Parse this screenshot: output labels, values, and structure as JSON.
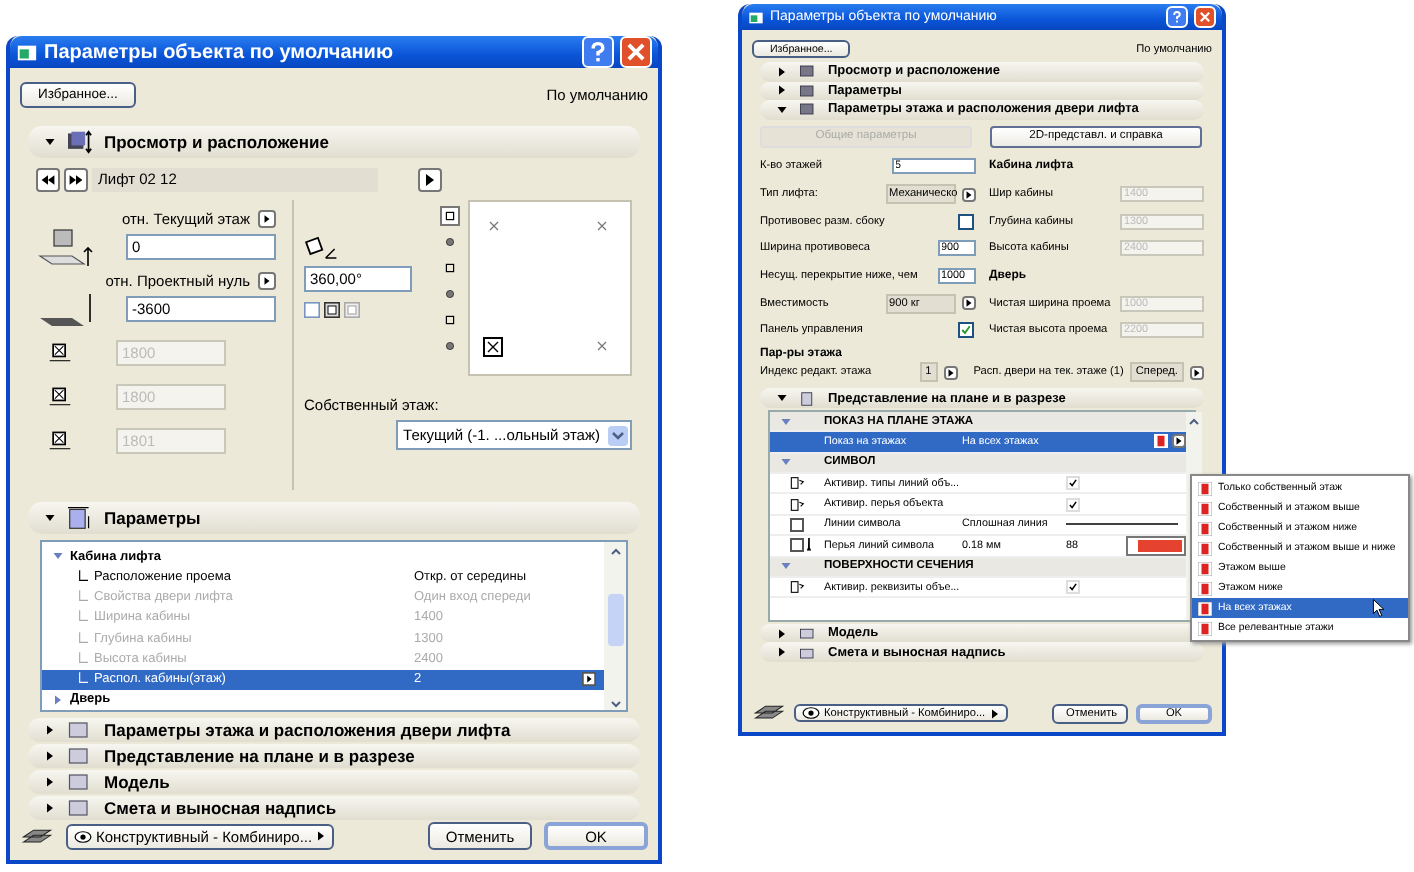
{
  "left_dialog": {
    "title": "Параметры объекта по умолчанию",
    "favorites_button": "Избранное...",
    "default_label": "По умолчанию",
    "placement": {
      "title": "Просмотр и расположение",
      "expanded": true,
      "library_part": "Лифт 02 12",
      "story_label": "отн. Текущий этаж",
      "story_value": "0",
      "zero_label": "отн. Проектный нуль",
      "zero_value": "-3600",
      "sizes": [
        {
          "value": "1800",
          "disabled": true
        },
        {
          "value": "1800",
          "disabled": true
        },
        {
          "value": "1801",
          "disabled": true
        }
      ],
      "angle": "360,00°",
      "views": [
        {
          "selected": true
        },
        {
          "selected": false
        },
        {
          "selected": false
        },
        {
          "selected": false
        },
        {
          "selected": false
        },
        {
          "selected": false
        }
      ],
      "own_story_label": "Собственный этаж:",
      "own_story_value": "Текущий (-1. ...ольный этаж)"
    },
    "parameters": {
      "title": "Параметры",
      "expanded": true,
      "tree": [
        {
          "name": "Кабина лифта",
          "expanded": true,
          "children": [
            {
              "name": "Расположение проема",
              "value": "Откр. от середины",
              "disabled": false,
              "selected": false
            },
            {
              "name": "Свойства двери лифта",
              "value": "Один вход спереди",
              "disabled": true,
              "selected": false
            },
            {
              "name": "Ширина кабины",
              "value": "1400",
              "disabled": true,
              "selected": false
            },
            {
              "name": "Глубина кабины",
              "value": "1300",
              "disabled": true,
              "selected": false
            },
            {
              "name": "Высота кабины",
              "value": "2400",
              "disabled": true,
              "selected": false
            },
            {
              "name": "Распол. кабины(этаж)",
              "value": "2",
              "disabled": false,
              "selected": true
            }
          ]
        },
        {
          "name": "Дверь",
          "expanded": false
        }
      ]
    },
    "sections": [
      {
        "title": "Параметры этажа и расположения двери лифта",
        "expanded": false
      },
      {
        "title": "Представление на плане и в разрезе",
        "expanded": false
      },
      {
        "title": "Модель",
        "expanded": false
      },
      {
        "title": "Смета и выносная надпись",
        "expanded": false
      }
    ],
    "layer": "Конструктивный - Комбиниро...",
    "cancel_button": "Отменить",
    "ok_button": "OK"
  },
  "right_dialog": {
    "title": "Параметры объекта по умолчанию",
    "favorites_button": "Избранное...",
    "default_label": "По умолчанию",
    "sections_top": [
      {
        "title": "Просмотр и расположение",
        "expanded": false
      },
      {
        "title": "Параметры",
        "expanded": false
      },
      {
        "title": "Параметры этажа и расположения двери лифта",
        "expanded": true
      }
    ],
    "tabs": [
      {
        "label": "Общие параметры",
        "selected": true
      },
      {
        "label": "2D-представл. и справка",
        "selected": false
      }
    ],
    "fields": [
      {
        "kind": "input",
        "label": "К-во этажей",
        "value": "5"
      },
      {
        "kind": "select",
        "label": "Тип лифта:",
        "value": "Механическо"
      },
      {
        "kind": "checkbox",
        "label": "Противовес разм. сбоку",
        "checked": false
      },
      {
        "kind": "number",
        "label": "Ширина противовеса",
        "value": "900"
      },
      {
        "kind": "number",
        "label": "Несущ. перекрытие ниже, чем",
        "value": "1000"
      },
      {
        "kind": "select",
        "label": "Вместимость",
        "value": "900 кг"
      },
      {
        "kind": "checkbox",
        "label": "Панель управления",
        "checked": true
      }
    ],
    "side": [
      {
        "kind": "heading",
        "label": "Кабина лифта"
      },
      {
        "kind": "field",
        "label": "Шир кабины",
        "value": "1400"
      },
      {
        "kind": "field",
        "label": "Глубина кабины",
        "value": "1300"
      },
      {
        "kind": "field",
        "label": "Высота кабины",
        "value": "2400"
      },
      {
        "kind": "heading",
        "label": "Дверь"
      },
      {
        "kind": "field",
        "label": "Чистая ширина проема",
        "value": "1000"
      },
      {
        "kind": "field",
        "label": "Чистая высота проема",
        "value": "2200"
      }
    ],
    "story_heading": "Пар-ры этажа",
    "story_fields": [
      {
        "label": "Индекс редакт. этажа",
        "value": "1"
      },
      {
        "label": "Расп. двери на тек. этаже (1)",
        "value": "Сперед."
      }
    ],
    "plan": {
      "title": "Представление на плане и в разрезе",
      "expanded": true,
      "rows": [
        {
          "kind": "group",
          "label": "ПОКАЗ НА ПЛАНЕ ЭТАЖА",
          "expanded": true
        },
        {
          "kind": "option",
          "label": "Показ на этажах",
          "value": "На всех этажах",
          "selected": true
        },
        {
          "kind": "group",
          "label": "СИМВОЛ",
          "expanded": true
        },
        {
          "kind": "check",
          "label": "Активир. типы линий объ...",
          "checked": true
        },
        {
          "kind": "check",
          "label": "Активир. перья объекта",
          "checked": true
        },
        {
          "kind": "line",
          "label": "Линии символа",
          "value": "Сплошная линия",
          "checked": false
        },
        {
          "kind": "pen",
          "label": "Перья линий символа",
          "value": "0.18 мм",
          "number": "88",
          "color": "#e5432f",
          "checked": false
        },
        {
          "kind": "group",
          "label": "ПОВЕРХНОСТИ СЕЧЕНИЯ",
          "expanded": true
        },
        {
          "kind": "check",
          "label": "Активир. реквизиты объе...",
          "checked": true
        }
      ]
    },
    "sections_bottom": [
      {
        "title": "Модель",
        "expanded": false
      },
      {
        "title": "Смета и выносная надпись",
        "expanded": false
      }
    ],
    "menu": [
      {
        "label": "Только собственный этаж",
        "selected": false
      },
      {
        "label": "Собственный и этажом выше",
        "selected": false
      },
      {
        "label": "Собственный и этажом ниже",
        "selected": false
      },
      {
        "label": "Собственный и этажом выше и ниже",
        "selected": false
      },
      {
        "label": "Этажом выше",
        "selected": false
      },
      {
        "label": "Этажом ниже",
        "selected": false
      },
      {
        "label": "На всех этажах",
        "selected": true
      },
      {
        "label": "Все релевантные этажи",
        "selected": false
      }
    ],
    "layer": "Конструктивный - Комбиниро...",
    "cancel_button": "Отменить",
    "ok_button": "OK"
  }
}
